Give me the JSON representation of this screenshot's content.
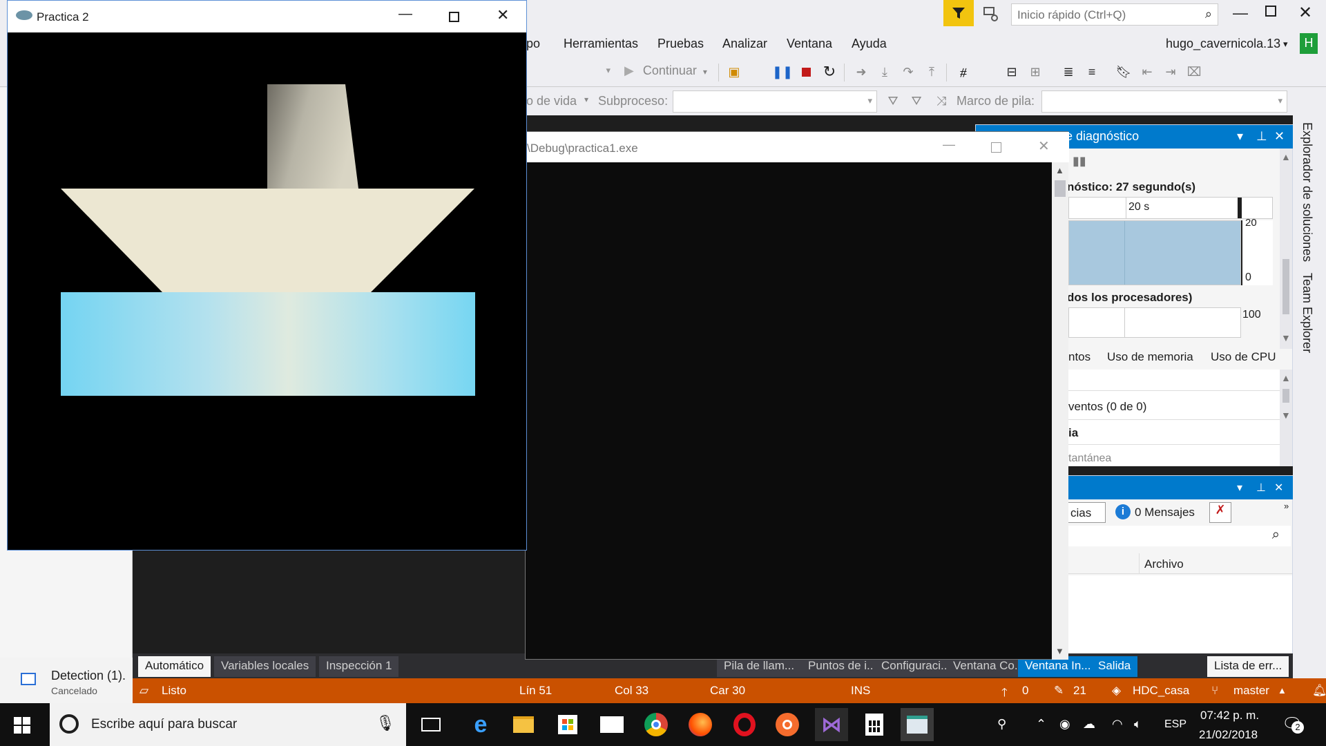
{
  "vs": {
    "quick_launch_placeholder": "Inicio rápido (Ctrl+Q)",
    "user_name": "hugo_cavernicola.13",
    "user_initial": "H",
    "menu": [
      "po",
      "Herramientas",
      "Pruebas",
      "Analizar",
      "Ventana",
      "Ayuda"
    ],
    "toolbar": {
      "continue_label": "Continuar",
      "lifecycle_label": "o de vida",
      "thread_label": "Subproceso:",
      "stack_label": "Marco de pila:"
    },
    "diagnostics": {
      "title": "e diagnóstico",
      "session_label": "nóstico: 27 segundo(s)",
      "time_mark": "20 s",
      "axis_top": "20",
      "axis_zero": "0",
      "processors_label": "dos los procesadores)",
      "cpu_max": "100",
      "tabs": [
        "ntos",
        "Uso de memoria",
        "Uso de CPU"
      ],
      "events_label": "ventos (0 de 0)",
      "section_label": "ia",
      "snapshot_label": "tantánea"
    },
    "errors": {
      "filter_label": "cias",
      "messages_label": "0 Mensajes",
      "column_file": "Archivo"
    },
    "side_tabs": [
      "Explorador de soluciones",
      "Team Explorer"
    ],
    "bottom_tabs_left": [
      "Automático",
      "Variables locales",
      "Inspección 1"
    ],
    "bottom_tabs_right": [
      "Pila de llam...",
      "Puntos de i...",
      "Configuraci...",
      "Ventana Co...",
      "Ventana In...",
      "Salida",
      "Lista de err..."
    ],
    "status": {
      "ready": "Listo",
      "line": "Lín 51",
      "col": "Col 33",
      "car": "Car 30",
      "ins": "INS",
      "up_count": "0",
      "edit_count": "21",
      "repo": "HDC_casa",
      "branch": "master"
    }
  },
  "console": {
    "title": "\\Debug\\practica1.exe"
  },
  "practica": {
    "title": "Practica 2"
  },
  "download": {
    "name": "Detection (1).",
    "status": "Cancelado"
  },
  "taskbar": {
    "search_placeholder": "Escribe aquí para buscar",
    "language": "ESP",
    "time": "07:42 p. m.",
    "date": "21/02/2018",
    "notifications": "2"
  },
  "colors": {
    "vs_accent": "#007acc",
    "status_bar": "#ca5100",
    "boat_hull": "#ece7d2",
    "water": "#7fd6ef"
  }
}
